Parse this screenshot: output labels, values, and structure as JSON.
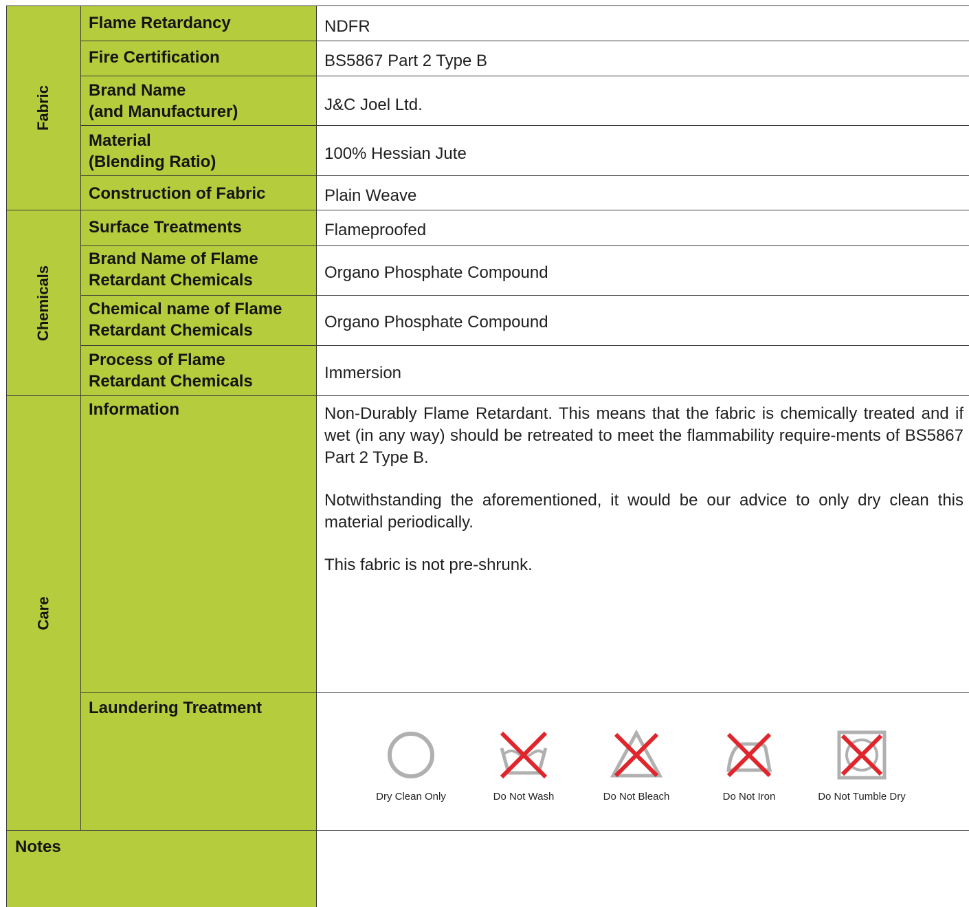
{
  "groups": {
    "fabric": "Fabric",
    "chemicals": "Chemicals",
    "care": "Care"
  },
  "rows": [
    {
      "label": "Flame Retardancy",
      "value": "NDFR"
    },
    {
      "label": "Fire Certification",
      "value": "BS5867 Part 2 Type B"
    },
    {
      "label": "Brand Name\n(and Manufacturer)",
      "value": "J&C Joel Ltd."
    },
    {
      "label": "Material\n(Blending Ratio)",
      "value": "100% Hessian Jute"
    },
    {
      "label": "Construction of Fabric",
      "value": "Plain Weave"
    },
    {
      "label": "Surface Treatments",
      "value": "Flameproofed"
    },
    {
      "label": "Brand Name of Flame\nRetardant Chemicals",
      "value": "Organo Phosphate Compound"
    },
    {
      "label": "Chemical name of Flame\nRetardant Chemicals",
      "value": "Organo Phosphate Compound"
    },
    {
      "label": "Process of Flame\nRetardant Chemicals",
      "value": "Immersion"
    }
  ],
  "care": {
    "information_label": "Information",
    "information_paragraphs": [
      "Non-Durably Flame Retardant. This means that the fabric is chemically treated and if wet (in any way) should be retreated to meet the flammability require-ments of BS5867 Part 2 Type B.",
      "Notwithstanding the aforementioned, it would be our advice to only dry clean this material periodically.",
      "This fabric is not pre-shrunk."
    ],
    "laundering_label": "Laundering Treatment",
    "symbols": [
      {
        "icon": "dry-clean-circle-icon",
        "caption": "Dry Clean Only"
      },
      {
        "icon": "do-not-wash-icon",
        "caption": "Do Not Wash"
      },
      {
        "icon": "do-not-bleach-icon",
        "caption": "Do Not Bleach"
      },
      {
        "icon": "do-not-iron-icon",
        "caption": "Do Not Iron"
      },
      {
        "icon": "do-not-tumble-dry-icon",
        "caption": "Do Not Tumble Dry"
      }
    ]
  },
  "notes": {
    "label": "Notes",
    "value": ""
  },
  "colors": {
    "green": "#b5cc3c",
    "cross": "#e0262c",
    "symbol": "#b0b0b0"
  }
}
